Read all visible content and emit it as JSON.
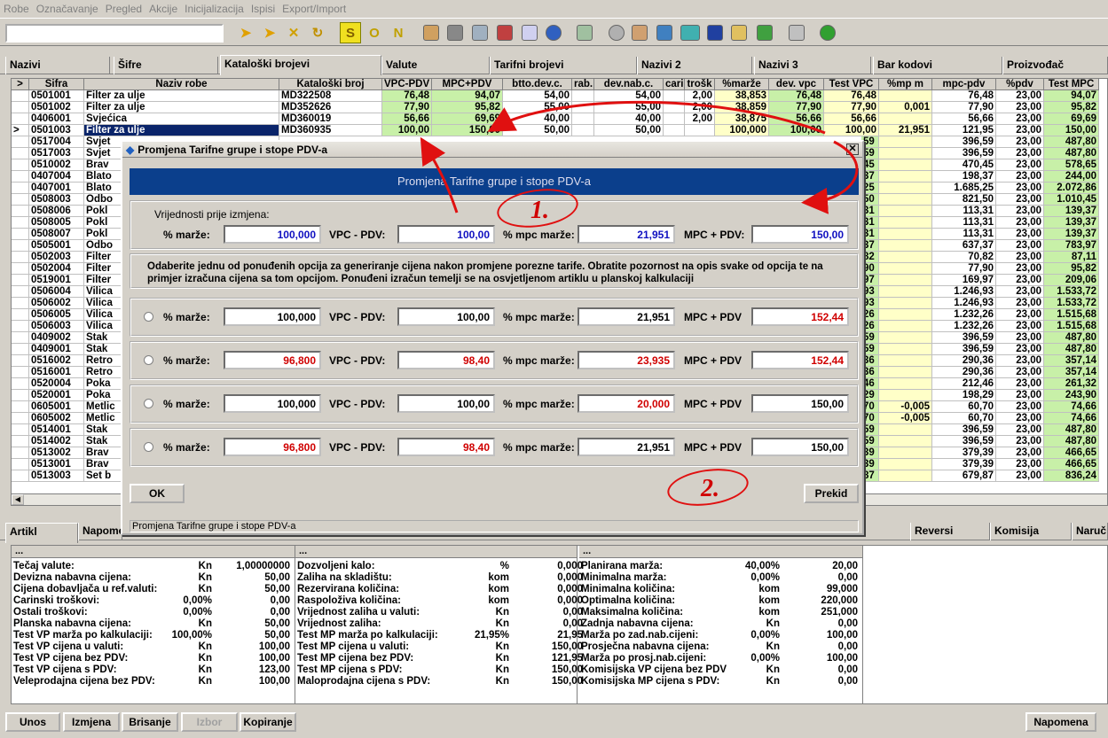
{
  "menu": [
    "Robe",
    "Označavanje",
    "Pregled",
    "Akcije",
    "Inicijalizacija",
    "Ispisi",
    "Export/Import"
  ],
  "toolbar": {
    "letters": [
      "S",
      "O",
      "N"
    ]
  },
  "tabs": [
    "Nazivi",
    "Šifre",
    "Kataloški brojevi",
    "Valute",
    "Tarifni brojevi",
    "Nazivi 2",
    "Nazivi 3",
    "Bar kodovi",
    "Proizvođač"
  ],
  "grid": {
    "headers": [
      "Šifra",
      "Naziv robe",
      "Kataloški broj",
      "VPC-PDV",
      "MPC+PDV",
      "btto.dev.c.",
      "rab.",
      "dev.nab.c.",
      "carin",
      "trošk",
      "%marže",
      "dev. vpc",
      "Test VPC",
      "%mp m",
      "mpc-pdv",
      "%pdv",
      "Test MPC"
    ],
    "top_rows": [
      {
        "sifra": "0501001",
        "naziv": "Filter za ulje",
        "kat": "MD322508",
        "vpc": "76,48",
        "mpc": "94,07",
        "btto": "54,00",
        "rab": "",
        "nab": "54,00",
        "carin": "",
        "trosk": "2,00",
        "marze": "38,853",
        "devvpc": "76,48",
        "testvpc": "76,48",
        "mpm": "",
        "mpcpdv": "76,48",
        "pdv": "23,00",
        "testmpc": "94,07"
      },
      {
        "sifra": "0501002",
        "naziv": "Filter za ulje",
        "kat": "MD352626",
        "vpc": "77,90",
        "mpc": "95,82",
        "btto": "55,00",
        "rab": "",
        "nab": "55,00",
        "carin": "",
        "trosk": "2,00",
        "marze": "38,859",
        "devvpc": "77,90",
        "testvpc": "77,90",
        "mpm": "0,001",
        "mpcpdv": "77,90",
        "pdv": "23,00",
        "testmpc": "95,82"
      },
      {
        "sifra": "0406001",
        "naziv": "Svjećica",
        "kat": "MD360019",
        "vpc": "56,66",
        "mpc": "69,69",
        "btto": "40,00",
        "rab": "",
        "nab": "40,00",
        "carin": "",
        "trosk": "2,00",
        "marze": "38,875",
        "devvpc": "56,66",
        "testvpc": "56,66",
        "mpm": "",
        "mpcpdv": "56,66",
        "pdv": "23,00",
        "testmpc": "69,69"
      },
      {
        "sifra": "0501003",
        "naziv": "Filter za ulje",
        "kat": "MD360935",
        "vpc": "100,00",
        "mpc": "150,00",
        "btto": "50,00",
        "rab": "",
        "nab": "50,00",
        "carin": "",
        "trosk": "",
        "marze": "100,000",
        "devvpc": "100,00",
        "testvpc": "100,00",
        "mpm": "21,951",
        "mpcpdv": "121,95",
        "pdv": "23,00",
        "testmpc": "150,00"
      }
    ],
    "rows": [
      {
        "sifra": "0517004",
        "naziv": "Svjet",
        "t": "59",
        "mpm": "",
        "mpcpdv": "396,59",
        "pdv": "23,00",
        "testmpc": "487,80"
      },
      {
        "sifra": "0517003",
        "naziv": "Svjet",
        "t": "59",
        "mpm": "",
        "mpcpdv": "396,59",
        "pdv": "23,00",
        "testmpc": "487,80"
      },
      {
        "sifra": "0510002",
        "naziv": "Brav",
        "t": "45",
        "mpm": "",
        "mpcpdv": "470,45",
        "pdv": "23,00",
        "testmpc": "578,65"
      },
      {
        "sifra": "0407004",
        "naziv": "Blato",
        "t": "37",
        "mpm": "",
        "mpcpdv": "198,37",
        "pdv": "23,00",
        "testmpc": "244,00"
      },
      {
        "sifra": "0407001",
        "naziv": "Blato",
        "t": "25",
        "mpm": "",
        "mpcpdv": "1.685,25",
        "pdv": "23,00",
        "testmpc": "2.072,86"
      },
      {
        "sifra": "0508003",
        "naziv": "Odbo",
        "t": "50",
        "mpm": "",
        "mpcpdv": "821,50",
        "pdv": "23,00",
        "testmpc": "1.010,45"
      },
      {
        "sifra": "0508006",
        "naziv": "Pokl",
        "t": "31",
        "mpm": "",
        "mpcpdv": "113,31",
        "pdv": "23,00",
        "testmpc": "139,37"
      },
      {
        "sifra": "0508005",
        "naziv": "Pokl",
        "t": "31",
        "mpm": "",
        "mpcpdv": "113,31",
        "pdv": "23,00",
        "testmpc": "139,37"
      },
      {
        "sifra": "0508007",
        "naziv": "Pokl",
        "t": "31",
        "mpm": "",
        "mpcpdv": "113,31",
        "pdv": "23,00",
        "testmpc": "139,37"
      },
      {
        "sifra": "0505001",
        "naziv": "Odbo",
        "t": "37",
        "mpm": "",
        "mpcpdv": "637,37",
        "pdv": "23,00",
        "testmpc": "783,97"
      },
      {
        "sifra": "0502003",
        "naziv": "Filter",
        "t": "82",
        "mpm": "",
        "mpcpdv": "70,82",
        "pdv": "23,00",
        "testmpc": "87,11"
      },
      {
        "sifra": "0502004",
        "naziv": "Filter",
        "t": "90",
        "mpm": "",
        "mpcpdv": "77,90",
        "pdv": "23,00",
        "testmpc": "95,82"
      },
      {
        "sifra": "0519001",
        "naziv": "Filter",
        "t": "97",
        "mpm": "",
        "mpcpdv": "169,97",
        "pdv": "23,00",
        "testmpc": "209,06"
      },
      {
        "sifra": "0506004",
        "naziv": "Vilica",
        "t": "93",
        "mpm": "",
        "mpcpdv": "1.246,93",
        "pdv": "23,00",
        "testmpc": "1.533,72"
      },
      {
        "sifra": "0506002",
        "naziv": "Vilica",
        "t": "93",
        "mpm": "",
        "mpcpdv": "1.246,93",
        "pdv": "23,00",
        "testmpc": "1.533,72"
      },
      {
        "sifra": "0506005",
        "naziv": "Vilica",
        "t": "26",
        "mpm": "",
        "mpcpdv": "1.232,26",
        "pdv": "23,00",
        "testmpc": "1.515,68"
      },
      {
        "sifra": "0506003",
        "naziv": "Vilica",
        "t": "26",
        "mpm": "",
        "mpcpdv": "1.232,26",
        "pdv": "23,00",
        "testmpc": "1.515,68"
      },
      {
        "sifra": "0409002",
        "naziv": "Stak",
        "t": "59",
        "mpm": "",
        "mpcpdv": "396,59",
        "pdv": "23,00",
        "testmpc": "487,80"
      },
      {
        "sifra": "0409001",
        "naziv": "Stak",
        "t": "59",
        "mpm": "",
        "mpcpdv": "396,59",
        "pdv": "23,00",
        "testmpc": "487,80"
      },
      {
        "sifra": "0516002",
        "naziv": "Retro",
        "t": "36",
        "mpm": "",
        "mpcpdv": "290,36",
        "pdv": "23,00",
        "testmpc": "357,14"
      },
      {
        "sifra": "0516001",
        "naziv": "Retro",
        "t": "36",
        "mpm": "",
        "mpcpdv": "290,36",
        "pdv": "23,00",
        "testmpc": "357,14"
      },
      {
        "sifra": "0520004",
        "naziv": "Poka",
        "t": "46",
        "mpm": "",
        "mpcpdv": "212,46",
        "pdv": "23,00",
        "testmpc": "261,32"
      },
      {
        "sifra": "0520001",
        "naziv": "Poka",
        "t": "29",
        "mpm": "",
        "mpcpdv": "198,29",
        "pdv": "23,00",
        "testmpc": "243,90"
      },
      {
        "sifra": "0605001",
        "naziv": "Metlic",
        "t": "70",
        "mpm": "-0,005",
        "mpcpdv": "60,70",
        "pdv": "23,00",
        "testmpc": "74,66"
      },
      {
        "sifra": "0605002",
        "naziv": "Metlic",
        "t": "70",
        "mpm": "-0,005",
        "mpcpdv": "60,70",
        "pdv": "23,00",
        "testmpc": "74,66"
      },
      {
        "sifra": "0514001",
        "naziv": "Stak",
        "t": "59",
        "mpm": "",
        "mpcpdv": "396,59",
        "pdv": "23,00",
        "testmpc": "487,80"
      },
      {
        "sifra": "0514002",
        "naziv": "Stak",
        "t": "59",
        "mpm": "",
        "mpcpdv": "396,59",
        "pdv": "23,00",
        "testmpc": "487,80"
      },
      {
        "sifra": "0513002",
        "naziv": "Brav",
        "t": "39",
        "mpm": "",
        "mpcpdv": "379,39",
        "pdv": "23,00",
        "testmpc": "466,65"
      },
      {
        "sifra": "0513001",
        "naziv": "Brav",
        "t": "39",
        "mpm": "",
        "mpcpdv": "379,39",
        "pdv": "23,00",
        "testmpc": "466,65"
      },
      {
        "sifra": "0513003",
        "naziv": "Set b",
        "t": "87",
        "mpm": "",
        "mpcpdv": "679,87",
        "pdv": "23,00",
        "testmpc": "836,24"
      }
    ]
  },
  "dialog": {
    "title": "Promjena Tarifne grupe i stope PDV-a",
    "banner": "Promjena Tarifne grupe i stope PDV-a",
    "before_label": "Vrijednosti prije izmjena:",
    "labels": {
      "marze": "% marže:",
      "vpc": "VPC - PDV:",
      "mpcm": "% mpc marže:",
      "mpc_colon": "MPC + PDV:",
      "mpc": "MPC + PDV"
    },
    "before": {
      "marze": "100,000",
      "vpc": "100,00",
      "mpcm": "21,951",
      "mpc": "150,00"
    },
    "info": "Odaberite jednu od ponuđenih opcija za generiranje cijena nakon promjene porezne tarife. Obratite pozornost na opis svake od opcija te na primjer izračuna cijena sa tom opcijom. Ponuđeni izračun temelji se na osvjetljenom artiklu u planskoj kalkulaciji",
    "options": [
      {
        "marze": "100,000",
        "vpc": "100,00",
        "mpcm": "21,951",
        "mpc": "152,44"
      },
      {
        "marze": "96,800",
        "vpc": "98,40",
        "mpcm": "23,935",
        "mpc": "152,44"
      },
      {
        "marze": "100,000",
        "vpc": "100,00",
        "mpcm": "20,000",
        "mpc": "150,00"
      },
      {
        "marze": "96,800",
        "vpc": "98,40",
        "mpcm": "21,951",
        "mpc": "150,00"
      }
    ],
    "ok": "OK",
    "cancel": "Prekid",
    "status": "Promjena Tarifne grupe i stope PDV-a",
    "anno1": "1.",
    "anno2": "2."
  },
  "bottom_tabs": [
    "Artikl",
    "Napome",
    "Reversi",
    "Komisija",
    "Naruč"
  ],
  "bottom": {
    "col1": [
      [
        "Tečaj valute:",
        "Kn",
        "1,00000000"
      ],
      [
        "Devizna nabavna cijena:",
        "Kn",
        "50,00"
      ],
      [
        "Cijena dobavljača u ref.valuti:",
        "Kn",
        "50,00"
      ],
      [
        "Carinski troškovi:",
        "0,00%",
        "0,00"
      ],
      [
        "Ostali troškovi:",
        "0,00%",
        "0,00"
      ],
      [
        "Planska nabavna cijena:",
        "Kn",
        "50,00"
      ],
      [
        "Test VP marža po kalkulaciji:",
        "100,00%",
        "50,00"
      ],
      [
        "Test VP cijena u valuti:",
        "Kn",
        "100,00"
      ],
      [
        "Test VP cijena bez PDV:",
        "Kn",
        "100,00"
      ],
      [
        "Test VP cijena s PDV:",
        "Kn",
        "123,00"
      ],
      [
        "Veleprodajna cijena bez PDV:",
        "Kn",
        "100,00"
      ]
    ],
    "col2": [
      [
        "Dozvoljeni kalo:",
        "%",
        "0,000"
      ],
      [
        "Zaliha na skladištu:",
        "kom",
        "0,000"
      ],
      [
        "Rezervirana količina:",
        "kom",
        "0,000"
      ],
      [
        "Raspoloživa količina:",
        "kom",
        "0,000"
      ],
      [
        "Vrijednost zaliha u valuti:",
        "Kn",
        "0,00"
      ],
      [
        "Vrijednost zaliha:",
        "Kn",
        "0,00"
      ],
      [
        "Test MP marža po kalkulaciji:",
        "21,95%",
        "21,95"
      ],
      [
        "Test MP cijena u valuti:",
        "Kn",
        "150,00"
      ],
      [
        "Test MP cijena bez PDV:",
        "Kn",
        "121,95"
      ],
      [
        "Test MP cijena s PDV:",
        "Kn",
        "150,00"
      ],
      [
        "Maloprodajna cijena s PDV:",
        "Kn",
        "150,00"
      ]
    ],
    "col3": [
      [
        "Planirana marža:",
        "40,00%",
        "20,00"
      ],
      [
        "Minimalna marža:",
        "0,00%",
        "0,00"
      ],
      [
        "Minimalna količina:",
        "kom",
        "99,000"
      ],
      [
        "Optimalna količina:",
        "kom",
        "220,000"
      ],
      [
        "Maksimalna količina:",
        "kom",
        "251,000"
      ],
      [
        "Zadnja nabavna cijena:",
        "Kn",
        "0,00"
      ],
      [
        "Marža po zad.nab.cijeni:",
        "0,00%",
        "100,00"
      ],
      [
        "Prosječna nabavna cijena:",
        "Kn",
        "0,00"
      ],
      [
        "Marža po prosj.nab.cijeni:",
        "0,00%",
        "100,00"
      ],
      [
        "Komisijska VP cijena bez PDV",
        "Kn",
        "0,00"
      ],
      [
        "Komisijska MP cijena s PDV:",
        "Kn",
        "0,00"
      ]
    ]
  },
  "buttons": {
    "unos": "Unos",
    "izmjena": "Izmjena",
    "brisanje": "Brisanje",
    "izbor": "Izbor",
    "kopiranje": "Kopiranje",
    "napomena": "Napomena"
  },
  "bhdr": "..."
}
